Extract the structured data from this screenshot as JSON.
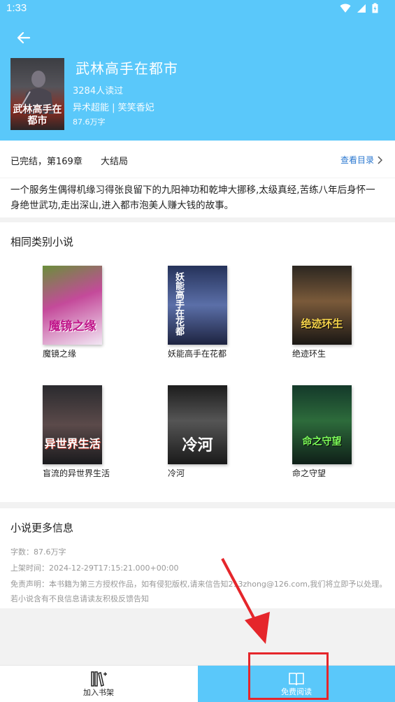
{
  "status_bar": {
    "time": "1:33"
  },
  "book": {
    "title": "武林高手在都市",
    "readers": "3284人读过",
    "genre": "异术超能 | 笑笑香妃",
    "word_count": "87.6万字",
    "cover_text": "武林高手在都市",
    "status": "已完结，第169章",
    "last_chapter": "大结局",
    "catalog_label": "查看目录",
    "description": "一个服务生偶得机缘习得张良留下的九阳神功和乾坤大挪移,太级真经,苦练八年后身怀一身绝世武功,走出深山,进入都市泡美人赚大钱的故事。"
  },
  "similar": {
    "title": "相同类别小说",
    "books": [
      {
        "title": "魔镜之缘",
        "cover_text": "魔镜之缘"
      },
      {
        "title": "妖能高手在花都",
        "cover_text": "妖能高手在花都"
      },
      {
        "title": "绝迹环生",
        "cover_text": "绝迹环生"
      },
      {
        "title": "盲流的异世界生活",
        "cover_text": "异世界生活"
      },
      {
        "title": "冷河",
        "cover_text": "冷河"
      },
      {
        "title": "命之守望",
        "cover_text": "命之守望"
      }
    ]
  },
  "more_info": {
    "title": "小说更多信息",
    "word_count": "字数：87.6万字",
    "shelf_time": "上架时间：2024-12-29T17:15:21.000+00:00",
    "disclaimer": "免责声明：本书籍为第三方授权作品，如有侵犯版权,请来信告知213zhong@126.com,我们将立即予以处理。 若小说含有不良信息请读友积极反馈告知"
  },
  "bottom_bar": {
    "add_shelf": "加入书架",
    "free_read": "免费阅读"
  },
  "icons": [
    "back-arrow-icon",
    "wifi-icon",
    "signal-icon",
    "battery-icon",
    "chevron-right-icon",
    "bookshelf-icon",
    "open-book-icon"
  ],
  "colors": {
    "primary": "#5ac8fa",
    "link": "#2b78d0",
    "annotation": "#e5262b"
  }
}
